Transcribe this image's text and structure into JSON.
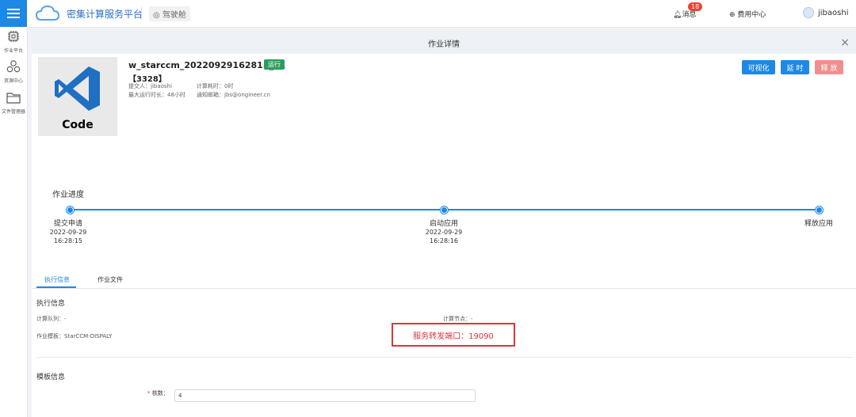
{
  "header": {
    "platform_title": "密集计算服务平台",
    "cockpit_label": "驾驶舱",
    "messages_label": "消息",
    "messages_count": "18",
    "fee_center_label": "费用中心",
    "username": "jibaoshi"
  },
  "sidebar": {
    "items": [
      {
        "label": "作业平台",
        "icon": "chip-icon"
      },
      {
        "label": "资源中心",
        "icon": "nodes-icon"
      },
      {
        "label": "文件管理器",
        "icon": "folder-icon"
      }
    ]
  },
  "panel": {
    "title": "作业详情"
  },
  "job": {
    "thumbnail_label": "Code",
    "name": "w_starccm_20220929162815_01",
    "id": "【3328】",
    "status": "运行",
    "submitter_label": "提交人：",
    "submitter": "jibaoshi",
    "compute_time_label": "计算耗时：",
    "compute_time": "0时",
    "max_runtime_label": "最大运行时长：",
    "max_runtime": "48小时",
    "notify_email_label": "通知邮箱：",
    "notify_email": "jbs@ongineer.cn"
  },
  "actions": {
    "visualize": "可视化",
    "delay": "延 时",
    "release": "释 放"
  },
  "progress": {
    "title": "作业进度",
    "steps": [
      {
        "label": "提交申请",
        "date": "2022-09-29",
        "time": "16:28:15"
      },
      {
        "label": "启动应用",
        "date": "2022-09-29",
        "time": "16:28:16"
      },
      {
        "label": "释放应用",
        "date": "",
        "time": ""
      }
    ]
  },
  "tabs": [
    {
      "label": "执行信息",
      "active": true
    },
    {
      "label": "作业文件",
      "active": false
    }
  ],
  "exec_info": {
    "title": "执行信息",
    "queue_label": "计算队列：",
    "queue_value": "-",
    "node_label": "计算节点：",
    "node_value": "-",
    "template_label": "作业模板：",
    "template_value": "StarCCM-DISPALY",
    "port_text": "服务转发端口：19090"
  },
  "template_info": {
    "title": "模板信息",
    "cores_label": "核数：",
    "cores_value": "4"
  },
  "colors": {
    "primary": "#1e88e5",
    "danger": "#d9363e",
    "success": "#2a9d5c"
  }
}
